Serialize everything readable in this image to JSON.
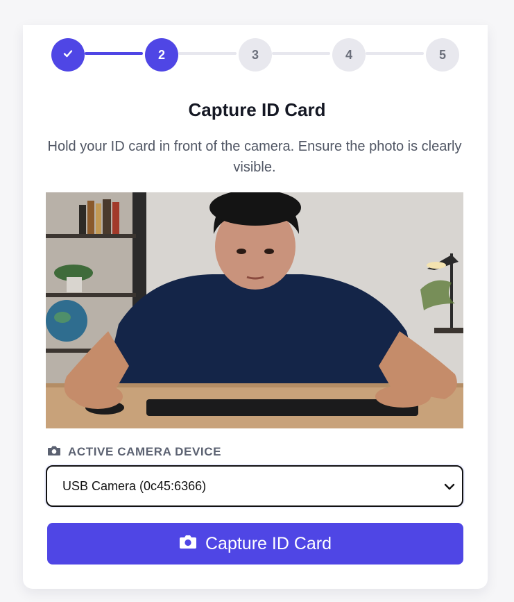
{
  "stepper": {
    "steps": [
      {
        "label": "",
        "state": "done",
        "icon": "check-icon"
      },
      {
        "label": "2",
        "state": "active"
      },
      {
        "label": "3",
        "state": "pending"
      },
      {
        "label": "4",
        "state": "pending"
      },
      {
        "label": "5",
        "state": "pending"
      }
    ]
  },
  "header": {
    "title": "Capture ID Card",
    "description": "Hold your ID card in front of the camera. Ensure the photo is clearly visible."
  },
  "camera": {
    "label": "ACTIVE CAMERA DEVICE",
    "label_icon": "camera-icon",
    "selected_device": "USB Camera (0c45:6366)"
  },
  "actions": {
    "capture_label": "Capture ID Card",
    "capture_icon": "camera-icon"
  },
  "colors": {
    "accent": "#4f46e5",
    "inactive_step": "#e8e8ee",
    "text_dark": "#151824",
    "text_muted": "#4f5563"
  }
}
